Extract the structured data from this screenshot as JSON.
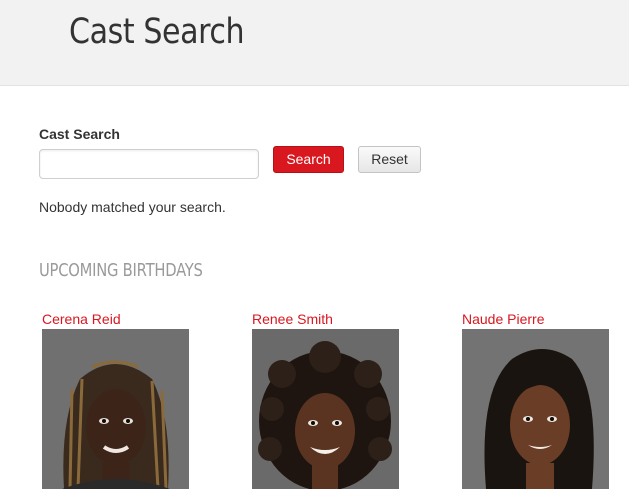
{
  "header": {
    "title": "Cast Search"
  },
  "search": {
    "label": "Cast Search",
    "input_value": "",
    "placeholder": "",
    "search_button": "Search",
    "reset_button": "Reset",
    "message": "Nobody matched your search."
  },
  "birthdays": {
    "heading": "UPCOMING BIRTHDAYS",
    "people": [
      {
        "name": "Cerena Reid"
      },
      {
        "name": "Renee Smith"
      },
      {
        "name": "Naude Pierre"
      }
    ]
  },
  "colors": {
    "accent": "#d9171f",
    "header_bg": "#f2f2f2",
    "heading_gray": "#9a9a9a"
  }
}
